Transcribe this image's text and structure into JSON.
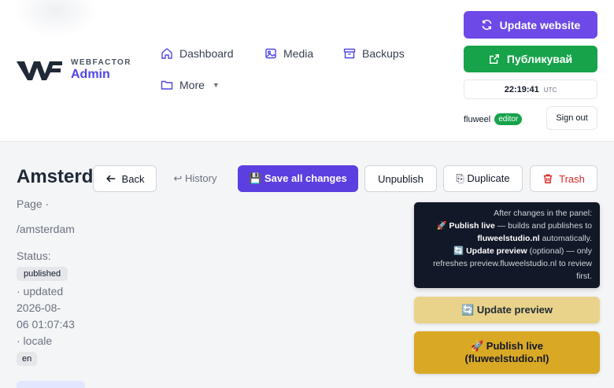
{
  "brand": {
    "top": "WEBFACTOR",
    "bottom": "Admin"
  },
  "nav": [
    {
      "label": "Dashboard",
      "icon": "home-icon"
    },
    {
      "label": "Media",
      "icon": "image-icon"
    },
    {
      "label": "Backups",
      "icon": "archive-icon"
    },
    {
      "label": "More",
      "icon": "folder-icon"
    }
  ],
  "actions": {
    "update_website": "Update website",
    "publish": "Публикувай"
  },
  "clock": {
    "time": "22:19:41",
    "tz": "UTC"
  },
  "user": {
    "name": "fluweel",
    "role": "editor",
    "signout": "Sign out"
  },
  "page": {
    "title": "Amsterd",
    "type": "Page ·",
    "slug": "/amsterdam",
    "status_label": "Status:",
    "status": "published",
    "updated_label": "· updated",
    "updated_date": "2026-08-",
    "updated_time": "06 01:07:43",
    "locale_label": "· locale",
    "locale": "en"
  },
  "toolbar": {
    "back": "Back",
    "history": "↩ History",
    "save": "💾 Save all changes",
    "unpublish": "Unpublish",
    "duplicate": "⎘ Duplicate",
    "trash": "Trash"
  },
  "help": {
    "intro": "After changes in the panel:",
    "live_emoji": "🚀",
    "live_label": "Publish live",
    "live_text": "— builds and publishes to",
    "live_domain": "fluweelstudio.nl",
    "live_tail": "automatically.",
    "preview_emoji": "🔄",
    "preview_label": "Update preview",
    "preview_text": "(optional) — only refreshes preview.fluweelstudio.nl to review first."
  },
  "publish_panel": {
    "preview_button": "🔄 Update preview",
    "live_button": "🚀 Publish live (fluweelstudio.nl)"
  },
  "colors": {
    "accent": "#6d4ae8",
    "success": "#16a34a",
    "danger": "#dc2626",
    "preview": "#e9d38a",
    "live": "#d9a825"
  }
}
